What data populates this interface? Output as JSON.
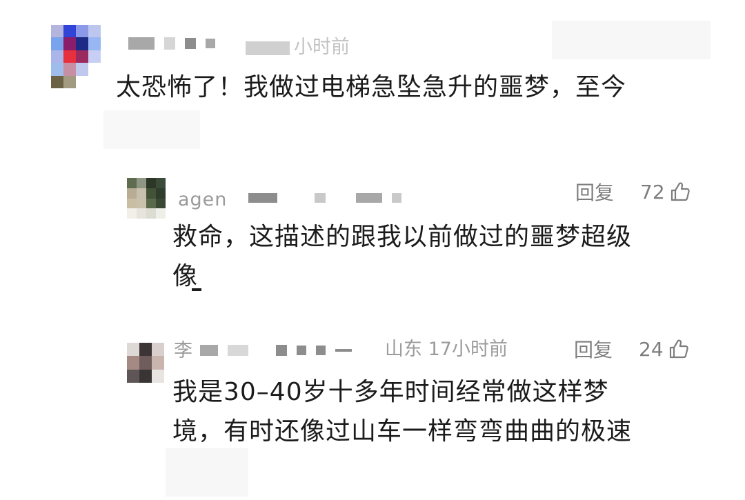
{
  "comments": [
    {
      "meta_fragment": "小时前",
      "text": "太恐怖了！我做过电梯急坠急升的噩梦，至今",
      "avatar_colors": [
        "#b3b5df",
        "#3243d8",
        "#8c99e8",
        "#bcc6ee",
        "#7aa3ee",
        "#8a1e6c",
        "#1d2a86",
        "#98b6f2",
        "#aab5e9",
        "#e6303d",
        "#9b2a5f",
        "#c8cff5",
        "#9fbdea",
        "#c68fa3",
        "#c0c8ee",
        "#ffffff",
        "#6b6144",
        "#a39a82",
        "#ffffff",
        "#ffffff"
      ]
    }
  ],
  "replies": [
    {
      "name_fragment": "agen",
      "reply_label": "回复",
      "likes": "72",
      "text_line1": "救命，这描述的跟我以前做过的噩梦超级",
      "text_line2": "像",
      "avatar_colors": [
        "#5f6c50",
        "#8f9684",
        "#2d3727",
        "#3a4b3a",
        "#b8ad94",
        "#c7c0ae",
        "#435338",
        "#2f3d2c",
        "#c9bda3",
        "#c9c1ac",
        "#596a4c",
        "#3a4833",
        "#f2efe8",
        "#e6e4dd",
        "#dcdcd3",
        "#efefe9",
        "#ffffff",
        "#ffffff",
        "#ffffff",
        "#ffffff"
      ]
    },
    {
      "name_fragment": "李",
      "location_time": "山东 17小时前",
      "reply_label": "回复",
      "likes": "24",
      "text_line1": "我是30–40岁十多年时间经常做这样梦",
      "text_line2": "境，有时还像过山车一样弯弯曲曲的极速",
      "avatar_colors": [
        "#ded9d6",
        "#3d3436",
        "#d9cfcc",
        "#a58a84",
        "#6f5d5d",
        "#c9b4ae",
        "#5e5656",
        "#3a3535",
        "#e8e4e2"
      ]
    }
  ],
  "icons": {
    "like": "thumbs-up-icon"
  }
}
